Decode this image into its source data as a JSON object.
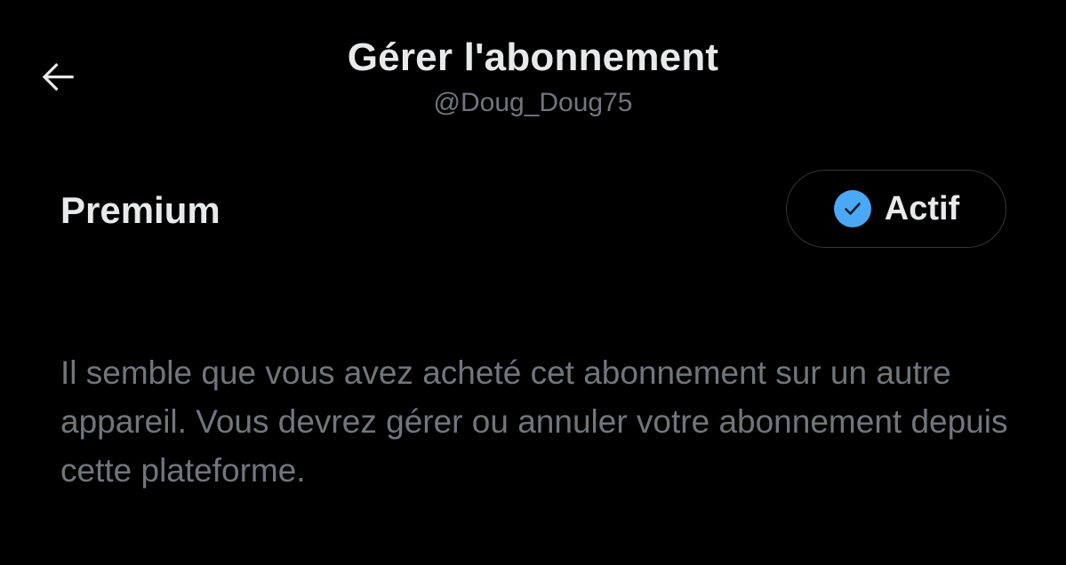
{
  "header": {
    "back_icon": "arrow-left-icon",
    "title": "Gérer l'abonnement",
    "username": "@Doug_Doug75"
  },
  "subscription": {
    "plan_name": "Premium",
    "status_label": "Actif",
    "status_icon": "check-circle-icon",
    "status_icon_color": "#4aa8f5"
  },
  "info": {
    "message": "Il semble que vous avez acheté cet abonnement sur un autre appareil. Vous devrez gérer ou annuler votre abonnement depuis cette plateforme."
  },
  "colors": {
    "background": "#000000",
    "primary_text": "#e7e9ea",
    "secondary_text": "#71767b",
    "pill_border": "#33363a"
  }
}
